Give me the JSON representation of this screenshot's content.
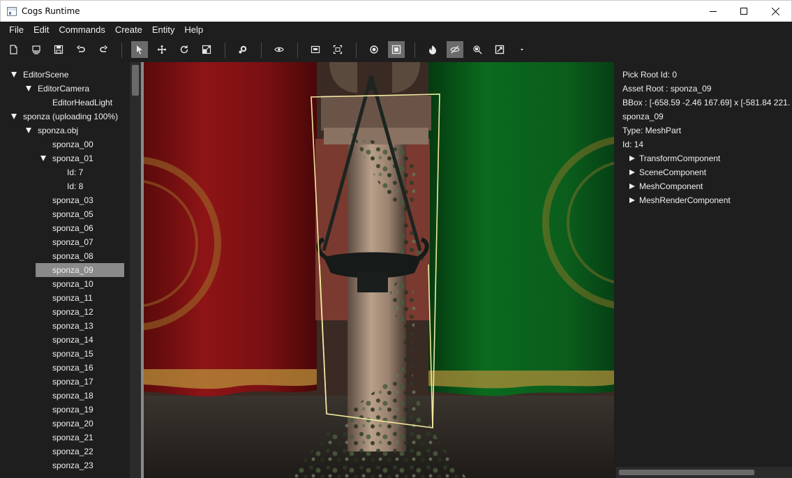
{
  "window": {
    "title": "Cogs Runtime"
  },
  "menu": [
    "File",
    "Edit",
    "Commands",
    "Create",
    "Entity",
    "Help"
  ],
  "toolbar": {
    "buttons": [
      "new-scene-icon",
      "load-icon",
      "save-icon",
      "undo-icon",
      "redo-icon",
      "select-icon",
      "move-icon",
      "rotate-icon",
      "scale-icon",
      "settings-icon",
      "eye-icon",
      "frame-icon",
      "frame-all-icon",
      "point-icon",
      "box-icon",
      "fire-icon",
      "hidden-icon",
      "pick-icon",
      "capture-icon",
      "dropdown-icon"
    ],
    "active": [
      "select-icon",
      "box-icon",
      "hidden-icon"
    ]
  },
  "scene_tree": [
    {
      "label": "EditorScene",
      "depth": 0,
      "expanded": true
    },
    {
      "label": "EditorCamera",
      "depth": 1,
      "expanded": true
    },
    {
      "label": "EditorHeadLight",
      "depth": 2,
      "expanded": null
    },
    {
      "label": "sponza (uploading 100%)",
      "depth": 0,
      "expanded": true
    },
    {
      "label": "sponza.obj",
      "depth": 1,
      "expanded": true
    },
    {
      "label": "sponza_00",
      "depth": 2,
      "expanded": null
    },
    {
      "label": "sponza_01",
      "depth": 2,
      "expanded": true
    },
    {
      "label": "Id: 7",
      "depth": 3,
      "expanded": null
    },
    {
      "label": "Id: 8",
      "depth": 3,
      "expanded": null
    },
    {
      "label": "sponza_03",
      "depth": 2,
      "expanded": null
    },
    {
      "label": "sponza_05",
      "depth": 2,
      "expanded": null
    },
    {
      "label": "sponza_06",
      "depth": 2,
      "expanded": null
    },
    {
      "label": "sponza_07",
      "depth": 2,
      "expanded": null
    },
    {
      "label": "sponza_08",
      "depth": 2,
      "expanded": null
    },
    {
      "label": "sponza_09",
      "depth": 2,
      "expanded": null,
      "selected": true
    },
    {
      "label": "sponza_10",
      "depth": 2,
      "expanded": null
    },
    {
      "label": "sponza_11",
      "depth": 2,
      "expanded": null
    },
    {
      "label": "sponza_12",
      "depth": 2,
      "expanded": null
    },
    {
      "label": "sponza_13",
      "depth": 2,
      "expanded": null
    },
    {
      "label": "sponza_14",
      "depth": 2,
      "expanded": null
    },
    {
      "label": "sponza_15",
      "depth": 2,
      "expanded": null
    },
    {
      "label": "sponza_16",
      "depth": 2,
      "expanded": null
    },
    {
      "label": "sponza_17",
      "depth": 2,
      "expanded": null
    },
    {
      "label": "sponza_18",
      "depth": 2,
      "expanded": null
    },
    {
      "label": "sponza_19",
      "depth": 2,
      "expanded": null
    },
    {
      "label": "sponza_20",
      "depth": 2,
      "expanded": null
    },
    {
      "label": "sponza_21",
      "depth": 2,
      "expanded": null
    },
    {
      "label": "sponza_22",
      "depth": 2,
      "expanded": null
    },
    {
      "label": "sponza_23",
      "depth": 2,
      "expanded": null
    }
  ],
  "properties": {
    "pick_root": "Pick Root Id: 0",
    "asset_root": "Asset Root : sponza_09",
    "bbox": "BBox : [-658.59 -2.46 167.69] x [-581.84 221.",
    "name": "sponza_09",
    "type": "Type: MeshPart",
    "id": "Id: 14",
    "components": [
      "TransformComponent",
      "SceneComponent",
      "MeshComponent",
      "MeshRenderComponent"
    ]
  },
  "colors": {
    "background": "#1e1e1e",
    "selection": "#8a8a8a",
    "highlight_outline": "#f2e9a0",
    "curtain_red": "#8e1416",
    "curtain_green": "#0a6a1e"
  }
}
